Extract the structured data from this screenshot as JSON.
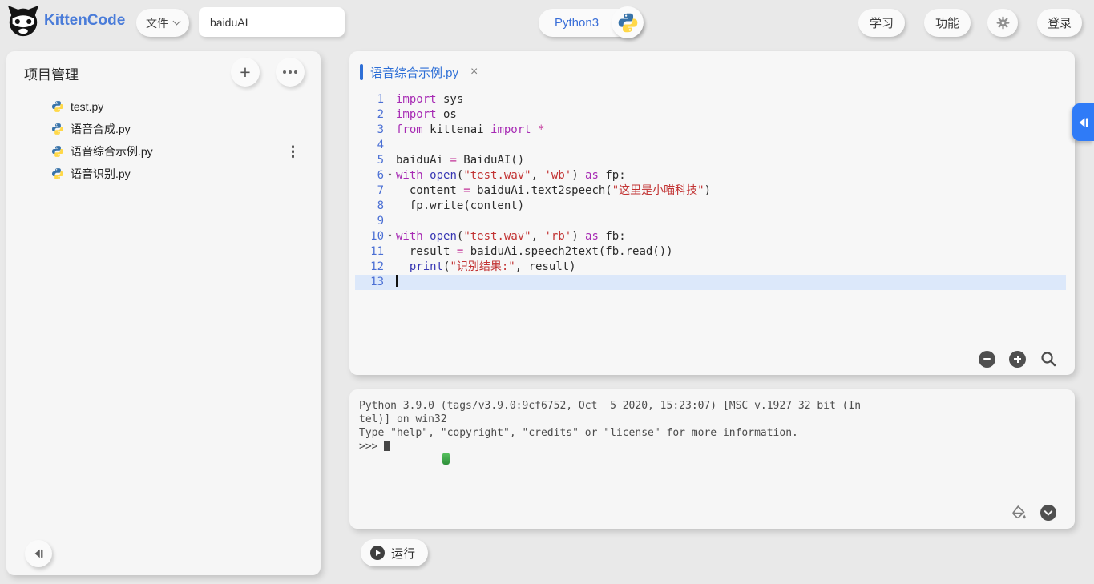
{
  "header": {
    "brand": "KittenCode",
    "file_menu": "文件",
    "project_name": "baiduAI",
    "runtime": "Python3",
    "learn": "学习",
    "features": "功能",
    "login": "登录"
  },
  "sidebar": {
    "title": "项目管理",
    "files": [
      {
        "name": "test.py"
      },
      {
        "name": "语音合成.py"
      },
      {
        "name": "语音综合示例.py",
        "menu": true
      },
      {
        "name": "语音识别.py"
      }
    ]
  },
  "editor": {
    "tab": {
      "title": "语音综合示例.py"
    },
    "lines": [
      {
        "num": "1",
        "tokens": [
          [
            "k",
            "import"
          ],
          [
            "p",
            " sys"
          ]
        ]
      },
      {
        "num": "2",
        "tokens": [
          [
            "k",
            "import"
          ],
          [
            "p",
            " os"
          ]
        ]
      },
      {
        "num": "3",
        "tokens": [
          [
            "k",
            "from"
          ],
          [
            "p",
            " kittenai "
          ],
          [
            "k",
            "import"
          ],
          [
            "p",
            " "
          ],
          [
            "o",
            "*"
          ]
        ]
      },
      {
        "num": "4",
        "tokens": []
      },
      {
        "num": "5",
        "tokens": [
          [
            "p",
            "baiduAi "
          ],
          [
            "o",
            "="
          ],
          [
            "p",
            " BaiduAI()"
          ]
        ]
      },
      {
        "num": "6",
        "fold": true,
        "tokens": [
          [
            "k",
            "with"
          ],
          [
            "p",
            " "
          ],
          [
            "b",
            "open"
          ],
          [
            "p",
            "("
          ],
          [
            "s",
            "\"test.wav\""
          ],
          [
            "p",
            ", "
          ],
          [
            "s",
            "'wb'"
          ],
          [
            "p",
            ") "
          ],
          [
            "k",
            "as"
          ],
          [
            "p",
            " fp:"
          ]
        ]
      },
      {
        "num": "7",
        "tokens": [
          [
            "p",
            "  content "
          ],
          [
            "o",
            "="
          ],
          [
            "p",
            " baiduAi.text2speech("
          ],
          [
            "s",
            "\"这里是小喵科技\""
          ],
          [
            "p",
            ")"
          ]
        ]
      },
      {
        "num": "8",
        "tokens": [
          [
            "p",
            "  fp.write(content)"
          ]
        ]
      },
      {
        "num": "9",
        "tokens": []
      },
      {
        "num": "10",
        "fold": true,
        "tokens": [
          [
            "k",
            "with"
          ],
          [
            "p",
            " "
          ],
          [
            "b",
            "open"
          ],
          [
            "p",
            "("
          ],
          [
            "s",
            "\"test.wav\""
          ],
          [
            "p",
            ", "
          ],
          [
            "s",
            "'rb'"
          ],
          [
            "p",
            ") "
          ],
          [
            "k",
            "as"
          ],
          [
            "p",
            " fb:"
          ]
        ]
      },
      {
        "num": "11",
        "tokens": [
          [
            "p",
            "  result "
          ],
          [
            "o",
            "="
          ],
          [
            "p",
            " baiduAi.speech2text(fb.read())"
          ]
        ]
      },
      {
        "num": "12",
        "tokens": [
          [
            "p",
            "  "
          ],
          [
            "b",
            "print"
          ],
          [
            "p",
            "("
          ],
          [
            "s",
            "\"识别结果:\""
          ],
          [
            "p",
            ", result)"
          ]
        ]
      },
      {
        "num": "13",
        "active": true,
        "cursor": true,
        "tokens": []
      }
    ]
  },
  "console": {
    "lines": [
      "Python 3.9.0 (tags/v3.9.0:9cf6752, Oct  5 2020, 15:23:07) [MSC v.1927 32 bit (In",
      "tel)] on win32",
      "Type \"help\", \"copyright\", \"credits\" or \"license\" for more information.",
      ">>> "
    ]
  },
  "run_label": "运行",
  "glyphs": {
    "plus": "+",
    "close": "×",
    "fold": "▾"
  },
  "colors": {
    "accent_blue": "#3a6fd8",
    "tab_blue": "#2e6fd6",
    "right_tab_blue": "#2f7bf7",
    "keyword": "#a72bb4",
    "string": "#c23333",
    "builtin": "#3636b3",
    "line_number": "#4a6fd4",
    "active_line_bg": "#dce8fa"
  }
}
